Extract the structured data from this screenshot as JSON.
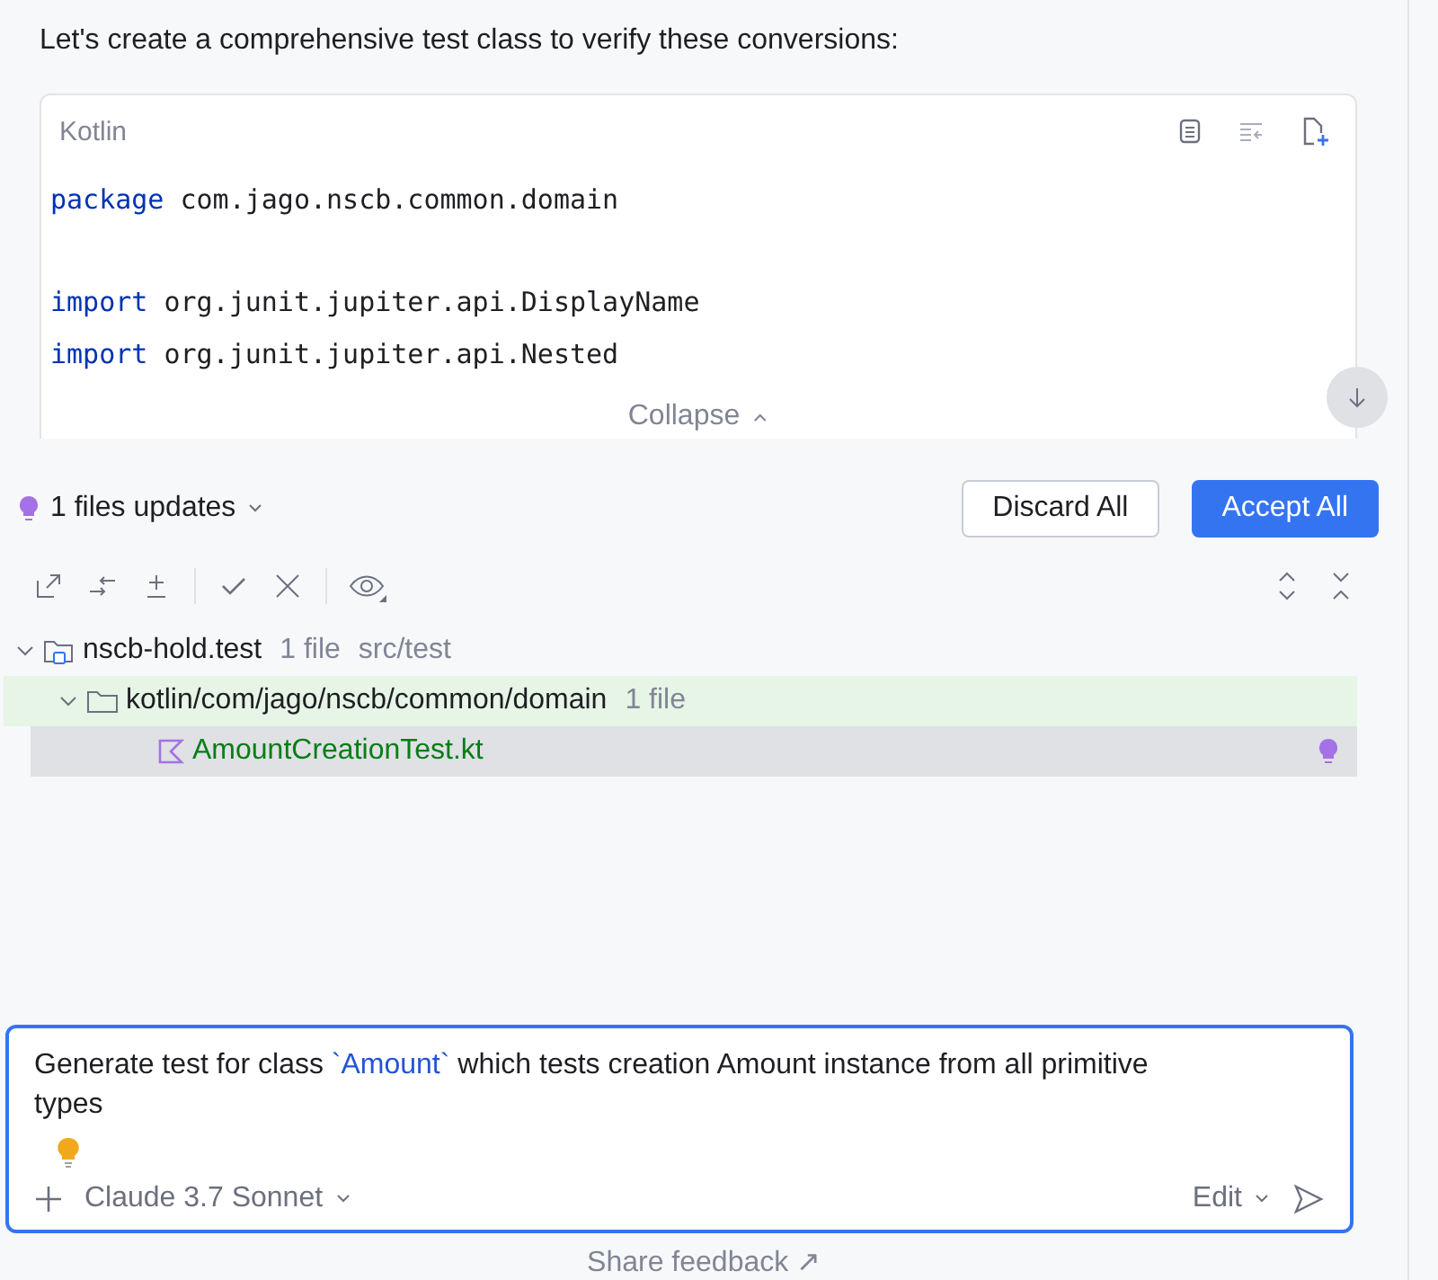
{
  "intro": "Let's create a comprehensive test class to verify these conversions:",
  "code_block": {
    "language": "Kotlin",
    "lines": [
      {
        "kind": "code",
        "tokens": [
          {
            "kind": "keyword",
            "text": "package"
          },
          {
            "kind": "plain",
            "text": " com.jago.nscb.common.domain"
          }
        ]
      },
      {
        "kind": "blank"
      },
      {
        "kind": "code",
        "tokens": [
          {
            "kind": "keyword",
            "text": "import"
          },
          {
            "kind": "plain",
            "text": " org.junit.jupiter.api.DisplayName"
          }
        ]
      },
      {
        "kind": "code",
        "tokens": [
          {
            "kind": "keyword",
            "text": "import"
          },
          {
            "kind": "plain",
            "text": " org.junit.jupiter.api.Nested"
          }
        ]
      }
    ],
    "collapse": "Collapse"
  },
  "changes": {
    "summary": "1 files updates",
    "discard": "Discard All",
    "accept": "Accept All",
    "tree": [
      {
        "name": "nscb-hold.test",
        "kind": "module",
        "count": "1 file",
        "path": "src/test",
        "expanded": true,
        "selected": false,
        "children": [
          {
            "name": "kotlin/com/jago/nscb/common/domain",
            "kind": "folder",
            "count": "1 file",
            "expanded": true,
            "selected": false,
            "children": [
              {
                "name": "AmountCreationTest.kt",
                "kind": "file",
                "selected": true
              }
            ]
          }
        ]
      }
    ]
  },
  "prompt": {
    "parts": [
      {
        "kind": "text",
        "text": "Generate test for class "
      },
      {
        "kind": "code",
        "text": "`Amount`"
      },
      {
        "kind": "text",
        "text": " which tests creation Amount instance from all primitive types"
      }
    ],
    "model": "Claude 3.7 Sonnet",
    "mode": "Edit"
  },
  "feedback": "Share feedback ↗"
}
